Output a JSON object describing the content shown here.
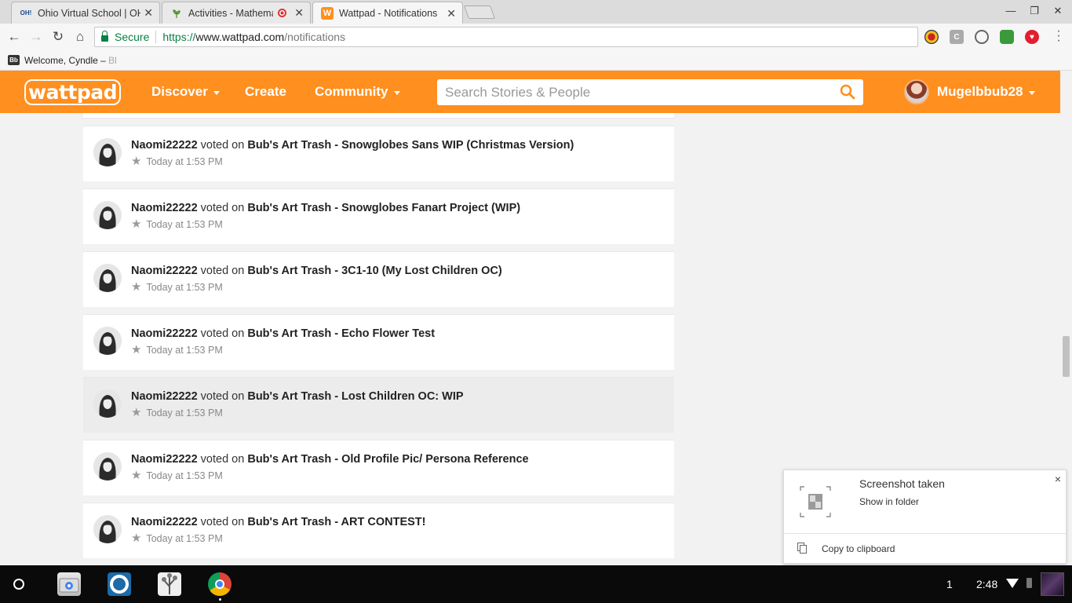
{
  "browser": {
    "tabs": [
      {
        "title": "Ohio Virtual School | OHVA",
        "favicon": "OH!"
      },
      {
        "title": "Activities - Mathematics",
        "recording": true
      },
      {
        "title": "Wattpad - Notifications",
        "active": true
      }
    ],
    "url": {
      "secure_label": "Secure",
      "scheme": "https://",
      "host": "www.wattpad.com",
      "path": "/notifications"
    },
    "bookmark": {
      "label": "Welcome, Cyndle –",
      "faded": "Bl",
      "icon": "Bb"
    }
  },
  "wattpad": {
    "logo": "wattpad",
    "nav": {
      "discover": "Discover",
      "create": "Create",
      "community": "Community"
    },
    "search_placeholder": "Search Stories & People",
    "username": "Mugelbbub28",
    "accent_color": "#ff8f1f"
  },
  "notifications": [
    {
      "user": "Naomi22222",
      "action": "voted on",
      "story": "Bub's Art Trash - Snowglobes Sans WIP (Christmas Version)",
      "time": "Today at 1:53 PM"
    },
    {
      "user": "Naomi22222",
      "action": "voted on",
      "story": "Bub's Art Trash - Snowglobes Fanart Project (WIP)",
      "time": "Today at 1:53 PM"
    },
    {
      "user": "Naomi22222",
      "action": "voted on",
      "story": "Bub's Art Trash - 3C1-10 (My Lost Children OC)",
      "time": "Today at 1:53 PM"
    },
    {
      "user": "Naomi22222",
      "action": "voted on",
      "story": "Bub's Art Trash - Echo Flower Test",
      "time": "Today at 1:53 PM"
    },
    {
      "user": "Naomi22222",
      "action": "voted on",
      "story": "Bub's Art Trash - Lost Children OC: WIP",
      "time": "Today at 1:53 PM",
      "hovered": true
    },
    {
      "user": "Naomi22222",
      "action": "voted on",
      "story": "Bub's Art Trash - Old Profile Pic/ Persona Reference",
      "time": "Today at 1:53 PM"
    },
    {
      "user": "Naomi22222",
      "action": "voted on",
      "story": "Bub's Art Trash - ART CONTEST!",
      "time": "Today at 1:53 PM"
    }
  ],
  "system_notification": {
    "title": "Screenshot taken",
    "subtitle": "Show in folder",
    "action": "Copy to clipboard",
    "close": "×"
  },
  "shelf": {
    "tray_count": "1",
    "time": "2:48"
  }
}
